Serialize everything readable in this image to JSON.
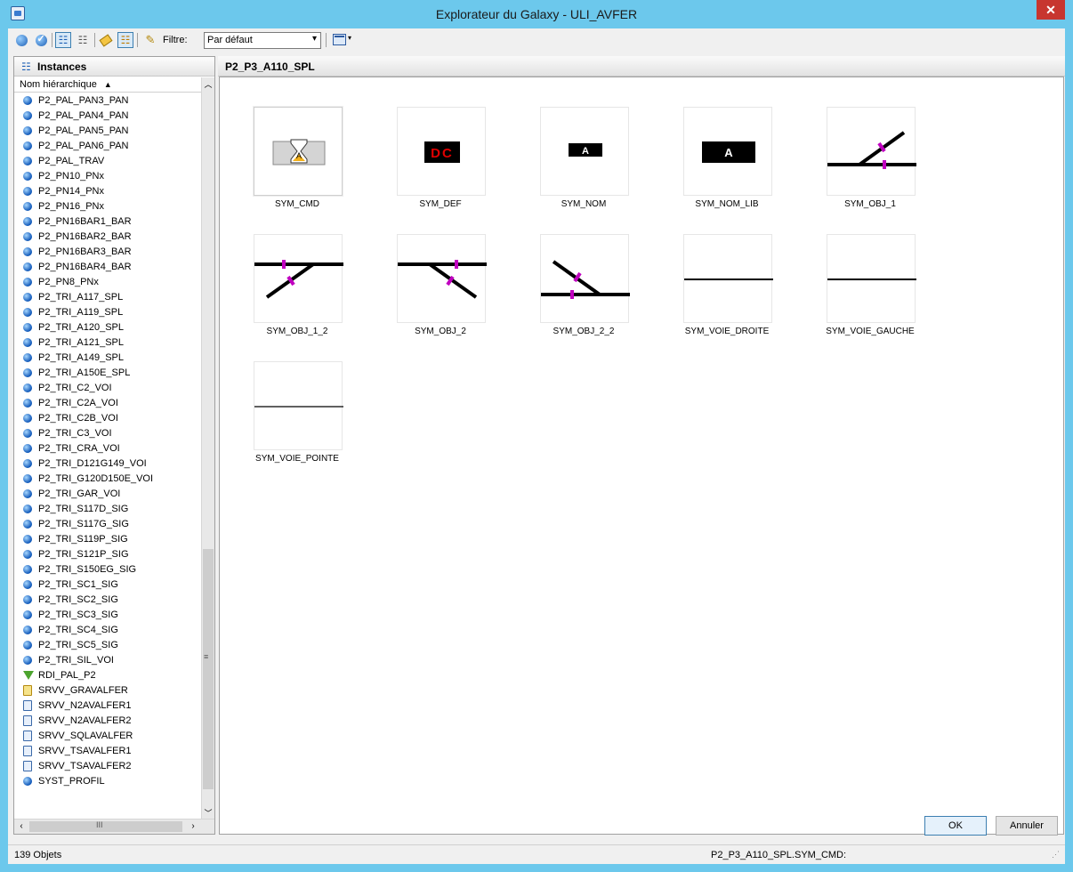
{
  "window": {
    "title": "Explorateur du Galaxy - ULI_AVFER",
    "close_label": "✕"
  },
  "toolbar": {
    "filter_label": "Filtre:",
    "filter_value": "Par défaut",
    "icons": [
      "globe-icon",
      "check-globe-icon",
      "list-view-icon",
      "tree-view-icon",
      "tag-icon",
      "hierarchy-icon",
      "filter-pen-icon",
      "view-mode-icon"
    ]
  },
  "left": {
    "header": "Instances",
    "column": "Nom hiérarchique",
    "items": [
      {
        "label": "P2_PAL_PAN3_PAN",
        "icon": "ball"
      },
      {
        "label": "P2_PAL_PAN4_PAN",
        "icon": "ball"
      },
      {
        "label": "P2_PAL_PAN5_PAN",
        "icon": "ball"
      },
      {
        "label": "P2_PAL_PAN6_PAN",
        "icon": "ball"
      },
      {
        "label": "P2_PAL_TRAV",
        "icon": "ball"
      },
      {
        "label": "P2_PN10_PNx",
        "icon": "ball"
      },
      {
        "label": "P2_PN14_PNx",
        "icon": "ball"
      },
      {
        "label": "P2_PN16_PNx",
        "icon": "ball"
      },
      {
        "label": "P2_PN16BAR1_BAR",
        "icon": "ball"
      },
      {
        "label": "P2_PN16BAR2_BAR",
        "icon": "ball"
      },
      {
        "label": "P2_PN16BAR3_BAR",
        "icon": "ball"
      },
      {
        "label": "P2_PN16BAR4_BAR",
        "icon": "ball"
      },
      {
        "label": "P2_PN8_PNx",
        "icon": "ball"
      },
      {
        "label": "P2_TRI_A117_SPL",
        "icon": "ball"
      },
      {
        "label": "P2_TRI_A119_SPL",
        "icon": "ball"
      },
      {
        "label": "P2_TRI_A120_SPL",
        "icon": "ball"
      },
      {
        "label": "P2_TRI_A121_SPL",
        "icon": "ball"
      },
      {
        "label": "P2_TRI_A149_SPL",
        "icon": "ball"
      },
      {
        "label": "P2_TRI_A150E_SPL",
        "icon": "ball"
      },
      {
        "label": "P2_TRI_C2_VOI",
        "icon": "ball"
      },
      {
        "label": "P2_TRI_C2A_VOI",
        "icon": "ball"
      },
      {
        "label": "P2_TRI_C2B_VOI",
        "icon": "ball"
      },
      {
        "label": "P2_TRI_C3_VOI",
        "icon": "ball"
      },
      {
        "label": "P2_TRI_CRA_VOI",
        "icon": "ball"
      },
      {
        "label": "P2_TRI_D121G149_VOI",
        "icon": "ball"
      },
      {
        "label": "P2_TRI_G120D150E_VOI",
        "icon": "ball"
      },
      {
        "label": "P2_TRI_GAR_VOI",
        "icon": "ball"
      },
      {
        "label": "P2_TRI_S117D_SIG",
        "icon": "ball"
      },
      {
        "label": "P2_TRI_S117G_SIG",
        "icon": "ball"
      },
      {
        "label": "P2_TRI_S119P_SIG",
        "icon": "ball"
      },
      {
        "label": "P2_TRI_S121P_SIG",
        "icon": "ball"
      },
      {
        "label": "P2_TRI_S150EG_SIG",
        "icon": "ball"
      },
      {
        "label": "P2_TRI_SC1_SIG",
        "icon": "ball"
      },
      {
        "label": "P2_TRI_SC2_SIG",
        "icon": "ball"
      },
      {
        "label": "P2_TRI_SC3_SIG",
        "icon": "ball"
      },
      {
        "label": "P2_TRI_SC4_SIG",
        "icon": "ball"
      },
      {
        "label": "P2_TRI_SC5_SIG",
        "icon": "ball"
      },
      {
        "label": "P2_TRI_SIL_VOI",
        "icon": "ball"
      },
      {
        "label": "RDI_PAL_P2",
        "icon": "funnel"
      },
      {
        "label": "SRVV_GRAVALFER",
        "icon": "script-yellow"
      },
      {
        "label": "SRVV_N2AVALFER1",
        "icon": "script"
      },
      {
        "label": "SRVV_N2AVALFER2",
        "icon": "script"
      },
      {
        "label": "SRVV_SQLAVALFER",
        "icon": "script"
      },
      {
        "label": "SRVV_TSAVALFER1",
        "icon": "script"
      },
      {
        "label": "SRVV_TSAVALFER2",
        "icon": "script"
      },
      {
        "label": "SYST_PROFIL",
        "icon": "ball"
      }
    ]
  },
  "right": {
    "header": "P2_P3_A110_SPL",
    "symbols": [
      {
        "label": "SYM_CMD",
        "kind": "cmd",
        "selected": true
      },
      {
        "label": "SYM_DEF",
        "kind": "def",
        "text": "DC"
      },
      {
        "label": "SYM_NOM",
        "kind": "nom",
        "text": "A"
      },
      {
        "label": "SYM_NOM_LIB",
        "kind": "nomlib",
        "text": "A"
      },
      {
        "label": "SYM_OBJ_1",
        "kind": "obj1"
      },
      {
        "label": "SYM_OBJ_1_2",
        "kind": "obj12"
      },
      {
        "label": "SYM_OBJ_2",
        "kind": "obj2"
      },
      {
        "label": "SYM_OBJ_2_2",
        "kind": "obj22"
      },
      {
        "label": "SYM_VOIE_DROITE",
        "kind": "line"
      },
      {
        "label": "SYM_VOIE_GAUCHE",
        "kind": "line"
      },
      {
        "label": "SYM_VOIE_POINTE",
        "kind": "line2"
      }
    ]
  },
  "buttons": {
    "ok": "OK",
    "cancel": "Annuler"
  },
  "status": {
    "count": "139 Objets",
    "path": "P2_P3_A110_SPL.SYM_CMD:"
  },
  "colors": {
    "marker": "#c000c0",
    "def_text": "#e00000",
    "titlebar": "#6cc8ec"
  }
}
